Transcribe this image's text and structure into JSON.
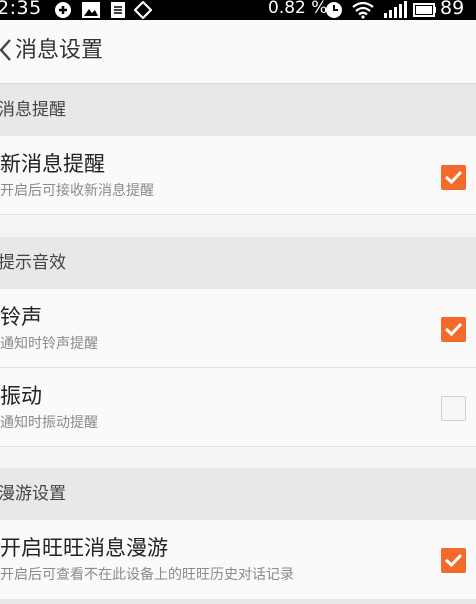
{
  "status_bar": {
    "time": "2:35",
    "battery_percent": "0.82 %",
    "battery_level": "89",
    "icons": [
      "notification-icon",
      "image-icon",
      "document-icon",
      "diamond-icon",
      "alarm-icon",
      "wifi-icon",
      "signal-icon",
      "battery-icon"
    ]
  },
  "header": {
    "back_icon": "chevron-left-icon",
    "title": "消息设置"
  },
  "sections": [
    {
      "title": "消息提醒",
      "items": [
        {
          "title": "新消息提醒",
          "subtitle": "开启后可接收新消息提醒",
          "checked": true
        }
      ]
    },
    {
      "title": "提示音效",
      "items": [
        {
          "title": "铃声",
          "subtitle": "通知时铃声提醒",
          "checked": true
        },
        {
          "title": "振动",
          "subtitle": "通知时振动提醒",
          "checked": false
        }
      ]
    },
    {
      "title": "漫游设置",
      "items": [
        {
          "title": "开启旺旺消息漫游",
          "subtitle": "开启后可查看不在此设备上的旺旺历史对话记录",
          "checked": true
        }
      ]
    }
  ],
  "colors": {
    "accent": "#f46a2b",
    "section_bg": "#e8e8e8",
    "row_bg": "#fafafa"
  }
}
